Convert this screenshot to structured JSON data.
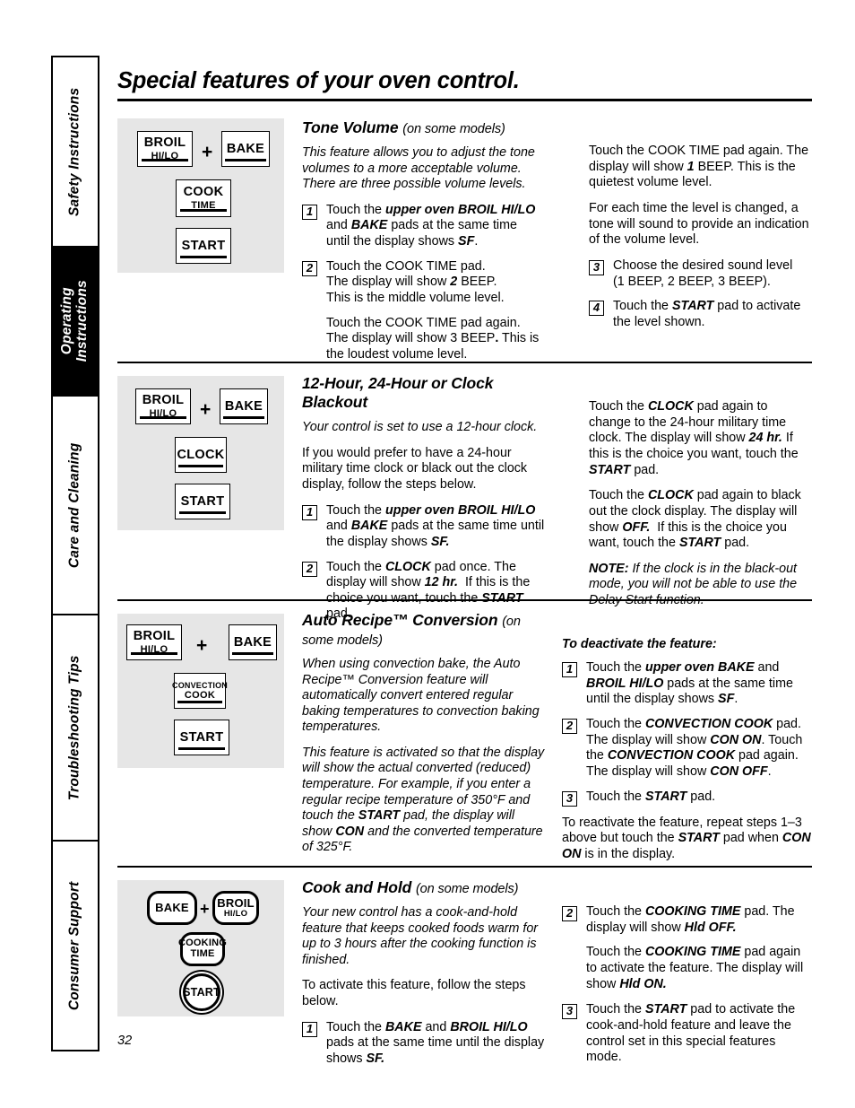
{
  "page": {
    "title": "Special features of your oven control.",
    "number": "32"
  },
  "sidebar": {
    "tabs": [
      {
        "label": "Safety Instructions",
        "active": false
      },
      {
        "label": "Operating Instructions",
        "active": true
      },
      {
        "label": "Care and Cleaning",
        "active": false
      },
      {
        "label": "Troubleshooting Tips",
        "active": false
      },
      {
        "label": "Consumer Support",
        "active": false
      }
    ]
  },
  "sections": [
    {
      "id": "tone-volume",
      "heading": "Tone Volume",
      "heading_note": "(on some models)",
      "pads": {
        "style": "square",
        "combo": [
          "BROIL / HI/LO",
          "BAKE"
        ],
        "plus": "+",
        "buttons": [
          {
            "l1": "BROIL",
            "l2": "HI/LO"
          },
          {
            "l1": "BAKE",
            "l2": ""
          },
          {
            "l1": "COOK",
            "l2": "TIME"
          },
          {
            "l1": "START",
            "l2": ""
          }
        ]
      },
      "left": {
        "intro": "This feature allows you to adjust the tone volumes to a more acceptable volume. There are three possible volume levels.",
        "steps": [
          {
            "num": "1",
            "html": "Touch the <b class=\"bi\">upper oven BROIL HI/LO</b> and <b class=\"bi\">BAKE</b> pads at the same time until the display shows <b class=\"bi\">SF</b>."
          },
          {
            "num": "2",
            "html": "Touch the COOK TIME pad.<br>The display will show <b class=\"bi\">2</b> BEEP.<br>This is the middle volume level."
          }
        ],
        "extra": "Touch the COOK TIME pad again. The display will show 3 BEEP<b class=\"b\">.</b> This is the loudest volume level."
      },
      "right": {
        "paras": [
          "Touch the COOK TIME pad again. The display will show <b class=\"bi\">1</b> BEEP. This is the quietest volume level.",
          "For each time the level is changed, a tone will sound to provide an indication of the volume level."
        ],
        "steps": [
          {
            "num": "3",
            "html": "Choose the desired sound level<br>(1 BEEP, 2 BEEP, 3 BEEP)."
          },
          {
            "num": "4",
            "html": "Touch the <b class=\"bi\">START</b> pad to activate the level shown."
          }
        ]
      }
    },
    {
      "id": "clock-blackout",
      "heading": "12-Hour, 24-Hour or Clock Blackout",
      "heading_note": "",
      "pads": {
        "style": "square",
        "buttons": [
          {
            "l1": "BROIL",
            "l2": "HI/LO"
          },
          {
            "l1": "BAKE",
            "l2": ""
          },
          {
            "l1": "CLOCK",
            "l2": ""
          },
          {
            "l1": "START",
            "l2": ""
          }
        ]
      },
      "left": {
        "intro": "Your control is set to use a 12-hour clock.",
        "para": "If you would prefer to have a 24-hour military time clock or black out the clock display, follow the steps below.",
        "steps": [
          {
            "num": "1",
            "html": "Touch the <b class=\"bi\">upper oven BROIL HI/LO</b> and <b class=\"bi\">BAKE</b> pads at the same time until the display shows <b class=\"bi\">SF.</b>"
          },
          {
            "num": "2",
            "html": "Touch the <b class=\"bi\">CLOCK</b> pad once. The display will show <b class=\"bi\">12 hr.</b>&nbsp; If this is the choice you want, touch the <b class=\"bi\">START</b> pad."
          }
        ]
      },
      "right": {
        "paras": [
          "Touch the <b class=\"bi\">CLOCK</b> pad again to change to the 24-hour military time clock. The display will show <b class=\"bi\">24 hr.</b> If this is the choice you want, touch the <b class=\"bi\">START</b> pad.",
          "Touch the <b class=\"bi\">CLOCK</b> pad again to black out the clock display. The display will show <b class=\"bi\">OFF.</b>&nbsp; If this is the choice you want, touch the <b class=\"bi\">START</b> pad."
        ],
        "note": "<b class=\"bi\">NOTE:</b> If the clock is in the black-out mode, you will not be able to use the Delay Start function."
      }
    },
    {
      "id": "auto-recipe-conversion",
      "heading": "Auto Recipe™ Conversion",
      "heading_note": "(on some models)",
      "pads": {
        "style": "square",
        "buttons": [
          {
            "l1": "BROIL",
            "l2": "HI/LO"
          },
          {
            "l1": "BAKE",
            "l2": ""
          },
          {
            "l1": "CONVECTION",
            "l2": "COOK"
          },
          {
            "l1": "START",
            "l2": ""
          }
        ]
      },
      "left": {
        "intro": "When using convection bake, the Auto Recipe™ Conversion feature will automatically convert entered regular baking temperatures to convection baking temperatures.",
        "intro2": "This feature is activated so that the display will show the actual converted (reduced) temperature. For example, if you enter a regular recipe temperature of 350°F and touch the <b class=\"bi\">START</b> pad, the display will show <b class=\"bi\">CON</b> and the converted temperature of 325°F."
      },
      "right": {
        "sub": "To deactivate the feature:",
        "steps": [
          {
            "num": "1",
            "html": "Touch the <b class=\"bi\">upper oven BAKE</b> and <b class=\"bi\">BROIL HI/LO</b> pads at the same time until the display shows <b class=\"bi\">SF</b>."
          },
          {
            "num": "2",
            "html": "Touch the <b class=\"bi\">CONVECTION COOK</b> pad. The display will show <b class=\"bi\">CON ON</b>. Touch the <b class=\"bi\">CONVECTION COOK</b> pad again. The display will show <b class=\"bi\">CON OFF</b>."
          },
          {
            "num": "3",
            "html": "Touch the <b class=\"bi\">START</b> pad."
          }
        ],
        "footer": "To reactivate the feature, repeat steps 1–3 above but touch the <b class=\"bi\">START</b> pad when <b class=\"bi\">CON ON</b> is in the display."
      }
    },
    {
      "id": "cook-and-hold",
      "heading": "Cook and Hold",
      "heading_note": "(on some models)",
      "pads": {
        "style": "rounded",
        "buttons": [
          {
            "l1": "BAKE",
            "l2": ""
          },
          {
            "l1": "BROIL",
            "l2": "HI/LO"
          },
          {
            "l1": "COOKING",
            "l2": "TIME"
          },
          {
            "l1": "START",
            "l2": ""
          }
        ]
      },
      "left": {
        "intro": "Your new control has a cook-and-hold feature that keeps cooked foods warm for up to 3 hours after the cooking function is finished.",
        "para": "To activate this feature, follow the steps below.",
        "steps": [
          {
            "num": "1",
            "html": "Touch the <b class=\"bi\">BAKE</b> and <b class=\"bi\">BROIL HI/LO</b> pads at the same time until the display shows <b class=\"bi\">SF.</b>"
          }
        ]
      },
      "right": {
        "steps": [
          {
            "num": "2",
            "html": "Touch the <b class=\"bi\">COOKING TIME</b> pad. The display will show <b class=\"bi\">Hld OFF.</b>"
          },
          {
            "num": "3",
            "html": "Touch the <b class=\"bi\">START</b> pad to activate the cook-and-hold feature and leave the control set in this special features mode."
          }
        ],
        "mid": "Touch the <b class=\"bi\">COOKING TIME</b> pad again to activate the feature. The display will show <b class=\"bi\">Hld ON.</b>"
      }
    }
  ],
  "colors": {
    "pad_panel_bg": "#e6e6e6",
    "ink": "#000000",
    "paper": "#ffffff"
  }
}
